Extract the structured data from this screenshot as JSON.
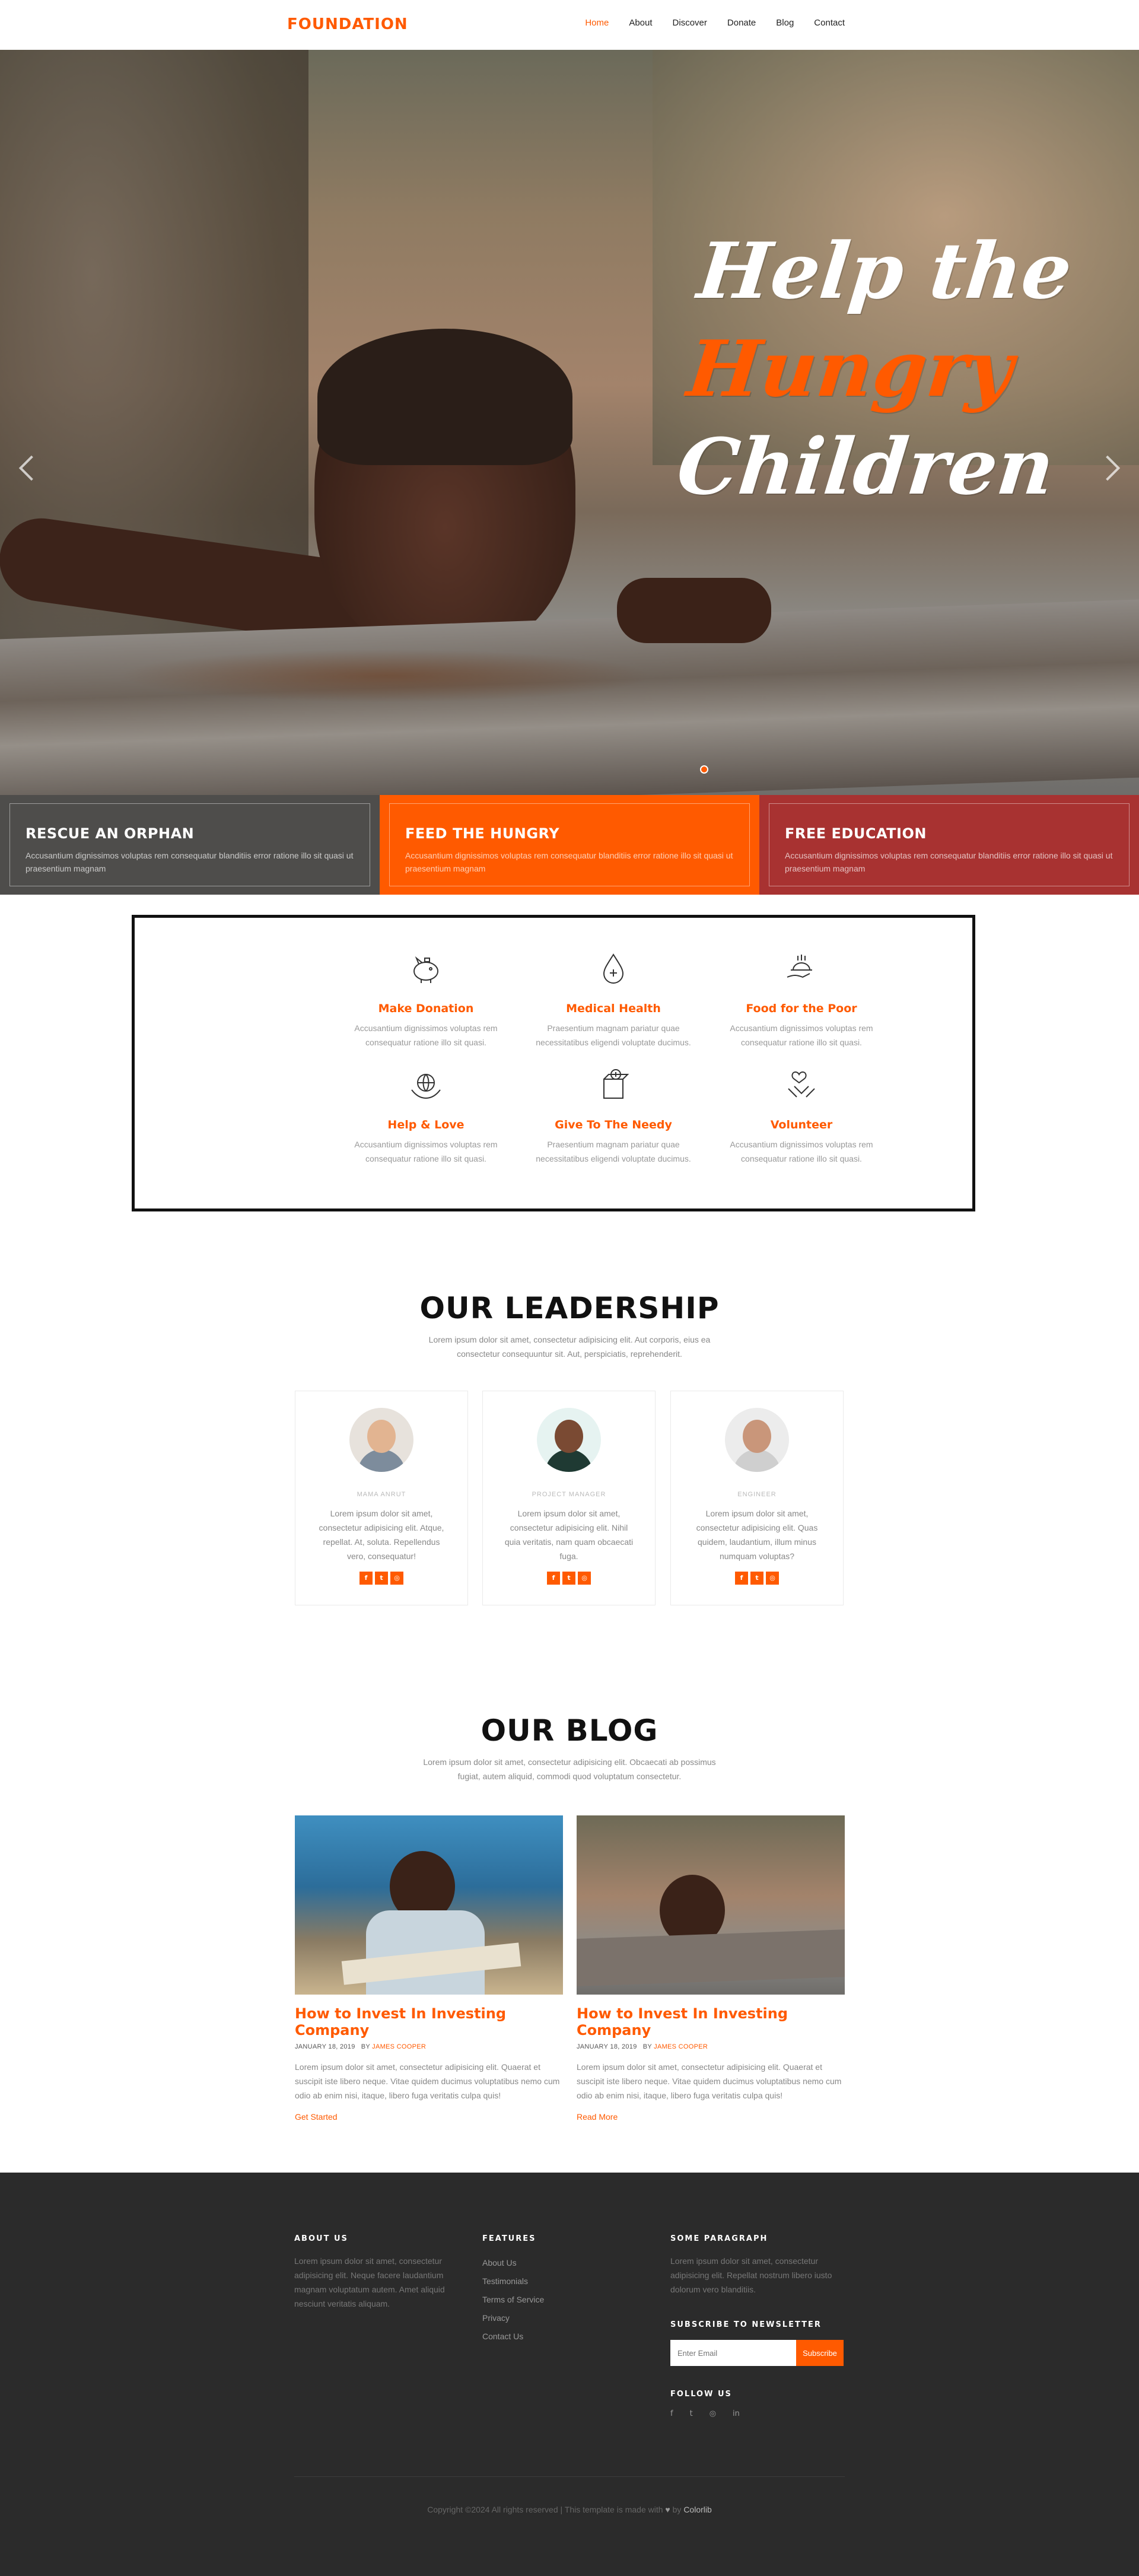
{
  "nav": {
    "brand": "FOUNDATION",
    "links": [
      "Home",
      "About",
      "Discover",
      "Donate",
      "Blog",
      "Contact"
    ]
  },
  "hero": {
    "line1": "Help the",
    "line2": "Hungry",
    "line3": "Children"
  },
  "features": [
    {
      "title": "RESCUE AN ORPHAN",
      "text": "Accusantium dignissimos voluptas rem consequatur blanditiis error ratione illo sit quasi ut praesentium magnam"
    },
    {
      "title": "FEED THE HUNGRY",
      "text": "Accusantium dignissimos voluptas rem consequatur blanditiis error ratione illo sit quasi ut praesentium magnam"
    },
    {
      "title": "FREE EDUCATION",
      "text": "Accusantium dignissimos voluptas rem consequatur blanditiis error ratione illo sit quasi ut praesentium magnam"
    }
  ],
  "services": [
    {
      "title": "Make Donation",
      "text": "Accusantium dignissimos voluptas rem consequatur ratione illo sit quasi."
    },
    {
      "title": "Medical Health",
      "text": "Praesentium magnam pariatur quae necessitatibus eligendi voluptate ducimus."
    },
    {
      "title": "Food for the Poor",
      "text": "Accusantium dignissimos voluptas rem consequatur ratione illo sit quasi."
    },
    {
      "title": "Help & Love",
      "text": "Accusantium dignissimos voluptas rem consequatur ratione illo sit quasi."
    },
    {
      "title": "Give To The Needy",
      "text": "Praesentium magnam pariatur quae necessitatibus eligendi voluptate ducimus."
    },
    {
      "title": "Volunteer",
      "text": "Accusantium dignissimos voluptas rem consequatur ratione illo sit quasi."
    }
  ],
  "leadership": {
    "title": "OUR LEADERSHIP",
    "subtitle": "Lorem ipsum dolor sit amet, consectetur adipisicing elit. Aut corporis, eius ea consectetur consequuntur sit. Aut, perspiciatis, reprehenderit.",
    "members": [
      {
        "role": "MAMA ANRUT",
        "text": "Lorem ipsum dolor sit amet, consectetur adipisicing elit. Atque, repellat. At, soluta. Repellendus vero, consequatur!"
      },
      {
        "role": "PROJECT MANAGER",
        "text": "Lorem ipsum dolor sit amet, consectetur adipisicing elit. Nihil quia veritatis, nam quam obcaecati fuga."
      },
      {
        "role": "ENGINEER",
        "text": "Lorem ipsum dolor sit amet, consectetur adipisicing elit. Quas quidem, laudantium, illum minus numquam voluptas?"
      }
    ]
  },
  "blog": {
    "title": "OUR BLOG",
    "subtitle": "Lorem ipsum dolor sit amet, consectetur adipisicing elit. Obcaecati ab possimus fugiat, autem aliquid, commodi quod voluptatum consectetur.",
    "posts": [
      {
        "title": "How to Invest In Investing Company",
        "date": "JANUARY 18, 2019",
        "by": "BY",
        "author": "JAMES COOPER",
        "text": "Lorem ipsum dolor sit amet, consectetur adipisicing elit. Quaerat et suscipit iste libero neque. Vitae quidem ducimus voluptatibus nemo cum odio ab enim nisi, itaque, libero fuga veritatis culpa quis!",
        "link": "Get Started"
      },
      {
        "title": "How to Invest In Investing Company",
        "date": "JANUARY 18, 2019",
        "by": "BY",
        "author": "JAMES COOPER",
        "text": "Lorem ipsum dolor sit amet, consectetur adipisicing elit. Quaerat et suscipit iste libero neque. Vitae quidem ducimus voluptatibus nemo cum odio ab enim nisi, itaque, libero fuga veritatis culpa quis!",
        "link": "Read More"
      }
    ]
  },
  "footer": {
    "about_title": "ABOUT US",
    "about_text": "Lorem ipsum dolor sit amet, consectetur adipisicing elit. Neque facere laudantium magnam voluptatum autem. Amet aliquid nesciunt veritatis aliquam.",
    "features_title": "FEATURES",
    "features_links": [
      "About Us",
      "Testimonials",
      "Terms of Service",
      "Privacy",
      "Contact Us"
    ],
    "para_title": "SOME PARAGRAPH",
    "para_text": "Lorem ipsum dolor sit amet, consectetur adipisicing elit. Repellat nostrum libero iusto dolorum vero blanditiis.",
    "newsletter_title": "SUBSCRIBE TO NEWSLETTER",
    "email_placeholder": "Enter Email",
    "subscribe_label": "Subscribe",
    "follow_title": "FOLLOW US",
    "social_icons": [
      "f",
      "t",
      "◎",
      "in"
    ],
    "copyright": "Copyright ©2024 All rights reserved | This template is made with",
    "heart": "♥",
    "by_text": "by",
    "colorlib": "Colorlib"
  }
}
